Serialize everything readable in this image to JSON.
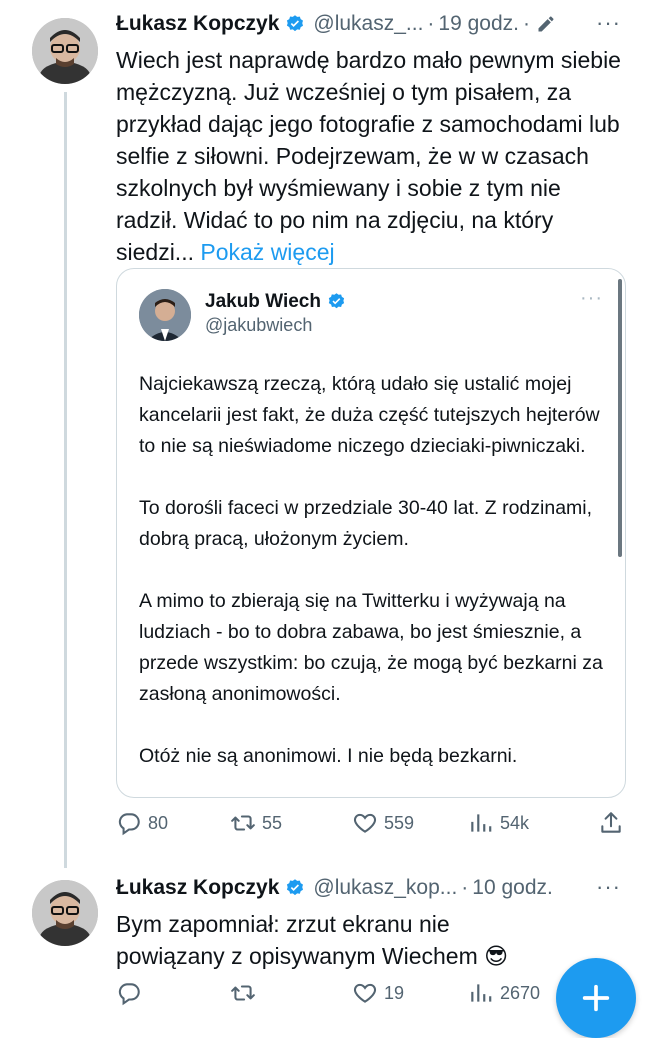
{
  "tweets": [
    {
      "author": "Łukasz Kopczyk",
      "handle": "@lukasz_...",
      "time": "19 godz.",
      "text": "Wiech jest naprawdę bardzo mało pewnym siebie mężczyzną. Już wcześniej o tym pisałem, za przykład dając jego fotografie z samochodami lub selfie z siłowni. Podejrzewam, że w w czasach szkolnych był wyśmiewany i sobie z tym nie radził. Widać to po nim na zdjęciu, na który siedzi...",
      "show_more": "Pokaż więcej",
      "replies": "80",
      "retweets": "55",
      "likes": "559",
      "views": "54k"
    },
    {
      "author": "Łukasz Kopczyk",
      "handle": "@lukasz_kop...",
      "time": "10 godz.",
      "text": "Bym zapomniał: zrzut ekranu nie powiązany z opisywanym Wiechem 😎",
      "likes": "19",
      "views": "2670"
    }
  ],
  "quote": {
    "author": "Jakub Wiech",
    "handle": "@jakubwiech",
    "paragraphs": [
      "Najciekawszą rzeczą, którą udało się ustalić mojej kancelarii jest fakt, że duża część tutejszych hejterów to nie są nieświadome niczego dzieciaki-piwniczaki.",
      "To dorośli faceci w przedziale 30-40 lat. Z rodzinami, dobrą pracą, ułożonym życiem.",
      "A mimo to zbierają się na Twitterku i wyżywają na ludziach - bo to dobra zabawa, bo jest śmiesznie, a przede wszystkim: bo czują, że mogą być bezkarni za zasłoną anonimowości.",
      "Otóż nie są anonimowi. I nie będą bezkarni."
    ]
  },
  "colors": {
    "accent": "#1d9bf0",
    "muted": "#536471",
    "border": "#cfd9de"
  },
  "icons": [
    "verified-badge-icon",
    "edit-pencil-icon",
    "more-icon",
    "reply-icon",
    "retweet-icon",
    "like-icon",
    "views-icon",
    "share-icon",
    "compose-plus-icon"
  ]
}
